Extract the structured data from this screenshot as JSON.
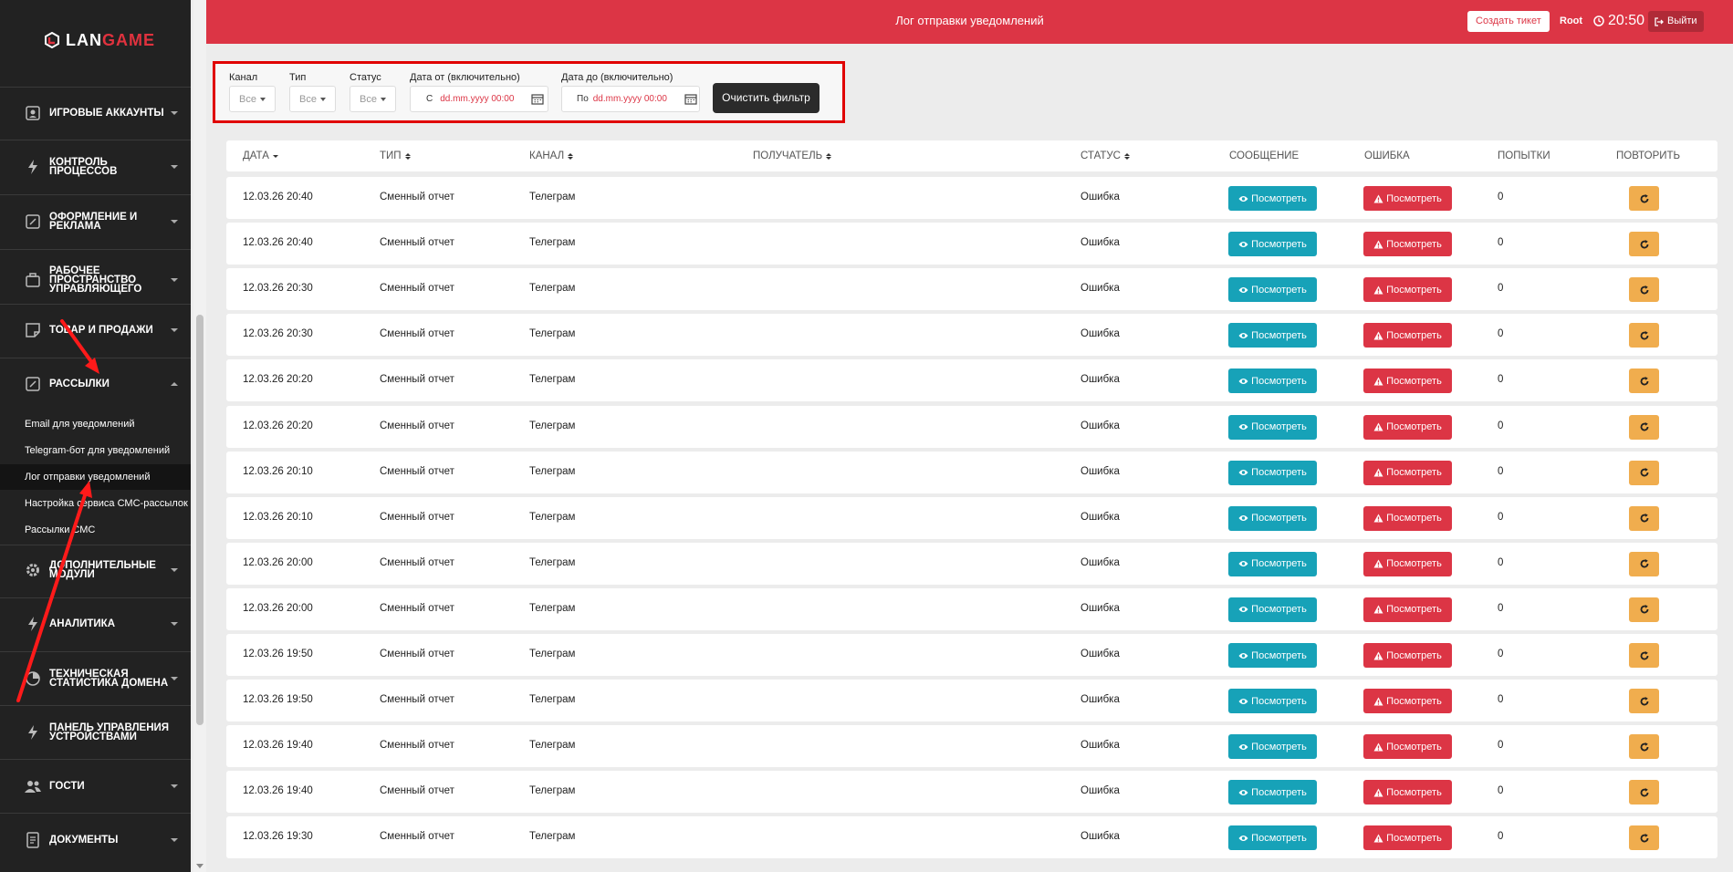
{
  "brand": {
    "logo_text_a": "LAN",
    "logo_text_b": "GAME",
    "accent": "#dc3545"
  },
  "header": {
    "title": "Лог отправки уведомлений",
    "ticket_button": "Создать тикет",
    "user": "Root",
    "time": "20:50",
    "logout": "Выйти"
  },
  "sidebar": {
    "items": [
      {
        "label": "Игровые аккаунты",
        "icon": "id-card-icon"
      },
      {
        "label": "Контроль процессов",
        "icon": "bolt-icon"
      },
      {
        "label": "Оформление и реклама",
        "icon": "edit-icon"
      },
      {
        "label": "Рабочее пространство управляющего",
        "icon": "briefcase-icon"
      },
      {
        "label": "Товар и продажи",
        "icon": "note-icon"
      },
      {
        "label": "Рассылки",
        "icon": "edit-icon"
      },
      {
        "label": "Дополнительные модули",
        "icon": "gear-icon"
      },
      {
        "label": "Аналитика",
        "icon": "bolt-icon"
      },
      {
        "label": "Техническая статистика домена",
        "icon": "pie-icon"
      },
      {
        "label": "Панель управления устройствами",
        "icon": "bolt-icon"
      },
      {
        "label": "Гости",
        "icon": "users-icon"
      },
      {
        "label": "Документы",
        "icon": "document-icon"
      }
    ],
    "subitems": [
      {
        "label": "Email для уведомлений"
      },
      {
        "label": "Telegram-бот для уведомлений"
      },
      {
        "label": "Лог отправки уведомлений"
      },
      {
        "label": "Настройка сервиса СМС-рассылок"
      },
      {
        "label": "Рассылки СМС"
      }
    ]
  },
  "filters": {
    "channel": {
      "label": "Канал",
      "value": "Все"
    },
    "type": {
      "label": "Тип",
      "value": "Все"
    },
    "status": {
      "label": "Статус",
      "value": "Все"
    },
    "date_from": {
      "label": "Дата от (включительно)",
      "prefix": "С",
      "placeholder": "dd.mm.yyyy 00:00"
    },
    "date_to": {
      "label": "Дата до (включительно)",
      "prefix": "По",
      "placeholder": "dd.mm.yyyy 00:00"
    },
    "clear_button": "Очистить фильтр"
  },
  "table": {
    "columns": [
      "Дата",
      "Тип",
      "Канал",
      "Получатель",
      "Статус",
      "Сообщение",
      "Ошибка",
      "Попытки",
      "Повторить"
    ],
    "view_label": "Посмотреть",
    "rows": [
      {
        "date": "12.03.26 20:40",
        "type": "Сменный отчет",
        "channel": "Телеграм",
        "recipient": "",
        "status": "Ошибка",
        "attempts": "0"
      },
      {
        "date": "12.03.26 20:40",
        "type": "Сменный отчет",
        "channel": "Телеграм",
        "recipient": "",
        "status": "Ошибка",
        "attempts": "0"
      },
      {
        "date": "12.03.26 20:30",
        "type": "Сменный отчет",
        "channel": "Телеграм",
        "recipient": "",
        "status": "Ошибка",
        "attempts": "0"
      },
      {
        "date": "12.03.26 20:30",
        "type": "Сменный отчет",
        "channel": "Телеграм",
        "recipient": "",
        "status": "Ошибка",
        "attempts": "0"
      },
      {
        "date": "12.03.26 20:20",
        "type": "Сменный отчет",
        "channel": "Телеграм",
        "recipient": "",
        "status": "Ошибка",
        "attempts": "0"
      },
      {
        "date": "12.03.26 20:20",
        "type": "Сменный отчет",
        "channel": "Телеграм",
        "recipient": "",
        "status": "Ошибка",
        "attempts": "0"
      },
      {
        "date": "12.03.26 20:10",
        "type": "Сменный отчет",
        "channel": "Телеграм",
        "recipient": "",
        "status": "Ошибка",
        "attempts": "0"
      },
      {
        "date": "12.03.26 20:10",
        "type": "Сменный отчет",
        "channel": "Телеграм",
        "recipient": "",
        "status": "Ошибка",
        "attempts": "0"
      },
      {
        "date": "12.03.26 20:00",
        "type": "Сменный отчет",
        "channel": "Телеграм",
        "recipient": "",
        "status": "Ошибка",
        "attempts": "0"
      },
      {
        "date": "12.03.26 20:00",
        "type": "Сменный отчет",
        "channel": "Телеграм",
        "recipient": "",
        "status": "Ошибка",
        "attempts": "0"
      },
      {
        "date": "12.03.26 19:50",
        "type": "Сменный отчет",
        "channel": "Телеграм",
        "recipient": "",
        "status": "Ошибка",
        "attempts": "0"
      },
      {
        "date": "12.03.26 19:50",
        "type": "Сменный отчет",
        "channel": "Телеграм",
        "recipient": "",
        "status": "Ошибка",
        "attempts": "0"
      },
      {
        "date": "12.03.26 19:40",
        "type": "Сменный отчет",
        "channel": "Телеграм",
        "recipient": "",
        "status": "Ошибка",
        "attempts": "0"
      },
      {
        "date": "12.03.26 19:40",
        "type": "Сменный отчет",
        "channel": "Телеграм",
        "recipient": "",
        "status": "Ошибка",
        "attempts": "0"
      },
      {
        "date": "12.03.26 19:30",
        "type": "Сменный отчет",
        "channel": "Телеграм",
        "recipient": "",
        "status": "Ошибка",
        "attempts": "0"
      }
    ]
  }
}
